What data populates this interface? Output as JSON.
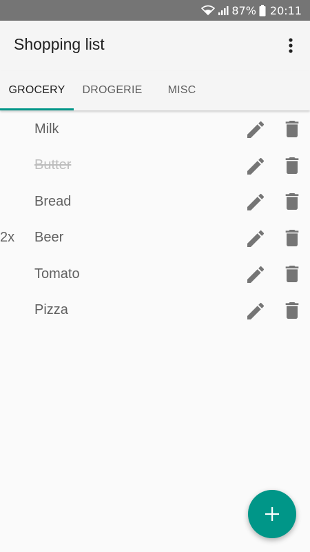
{
  "status_bar": {
    "battery": "87%",
    "time": "20:11"
  },
  "app_bar": {
    "title": "Shopping list",
    "menu_icon": "more-vert-icon"
  },
  "tabs": [
    {
      "label": "GROCERY",
      "active": true
    },
    {
      "label": "DROGERIE",
      "active": false
    },
    {
      "label": "MISC",
      "active": false
    }
  ],
  "items": [
    {
      "qty": "",
      "name": "Milk",
      "done": false
    },
    {
      "qty": "",
      "name": "Butter",
      "done": true
    },
    {
      "qty": "",
      "name": "Bread",
      "done": false
    },
    {
      "qty": "2x",
      "name": "Beer",
      "done": false
    },
    {
      "qty": "",
      "name": "Tomato",
      "done": false
    },
    {
      "qty": "",
      "name": "Pizza",
      "done": false
    }
  ],
  "row_actions": {
    "edit_icon": "pencil-icon",
    "delete_icon": "trash-icon"
  },
  "fab": {
    "icon": "plus-icon"
  },
  "colors": {
    "accent": "#009688",
    "status_bar": "#757575",
    "app_bar": "#f5f5f5",
    "icon_gray": "#757575"
  }
}
